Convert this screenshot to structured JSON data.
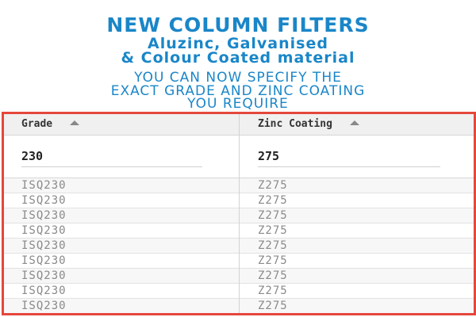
{
  "banner": {
    "line1": "NEW COLUMN FILTERS",
    "line2": "Aluzinc, Galvanised",
    "line3": "& Colour Coated material",
    "sub1": "YOU CAN NOW SPECIFY THE",
    "sub2": "EXACT GRADE AND ZINC COATING",
    "sub3": "YOU REQUIRE"
  },
  "table": {
    "headers": {
      "grade": "Grade",
      "zinc": "Zinc Coating"
    },
    "filters": {
      "grade": "230",
      "zinc": "275"
    },
    "rows": [
      {
        "grade": "ISQ230",
        "zinc": "Z275"
      },
      {
        "grade": "ISQ230",
        "zinc": "Z275"
      },
      {
        "grade": "ISQ230",
        "zinc": "Z275"
      },
      {
        "grade": "ISQ230",
        "zinc": "Z275"
      },
      {
        "grade": "ISQ230",
        "zinc": "Z275"
      },
      {
        "grade": "ISQ230",
        "zinc": "Z275"
      },
      {
        "grade": "ISQ230",
        "zinc": "Z275"
      },
      {
        "grade": "ISQ230",
        "zinc": "Z275"
      },
      {
        "grade": "ISQ230",
        "zinc": "Z275"
      }
    ]
  },
  "colors": {
    "accent": "#1a86c8",
    "frame": "#e5473c"
  }
}
